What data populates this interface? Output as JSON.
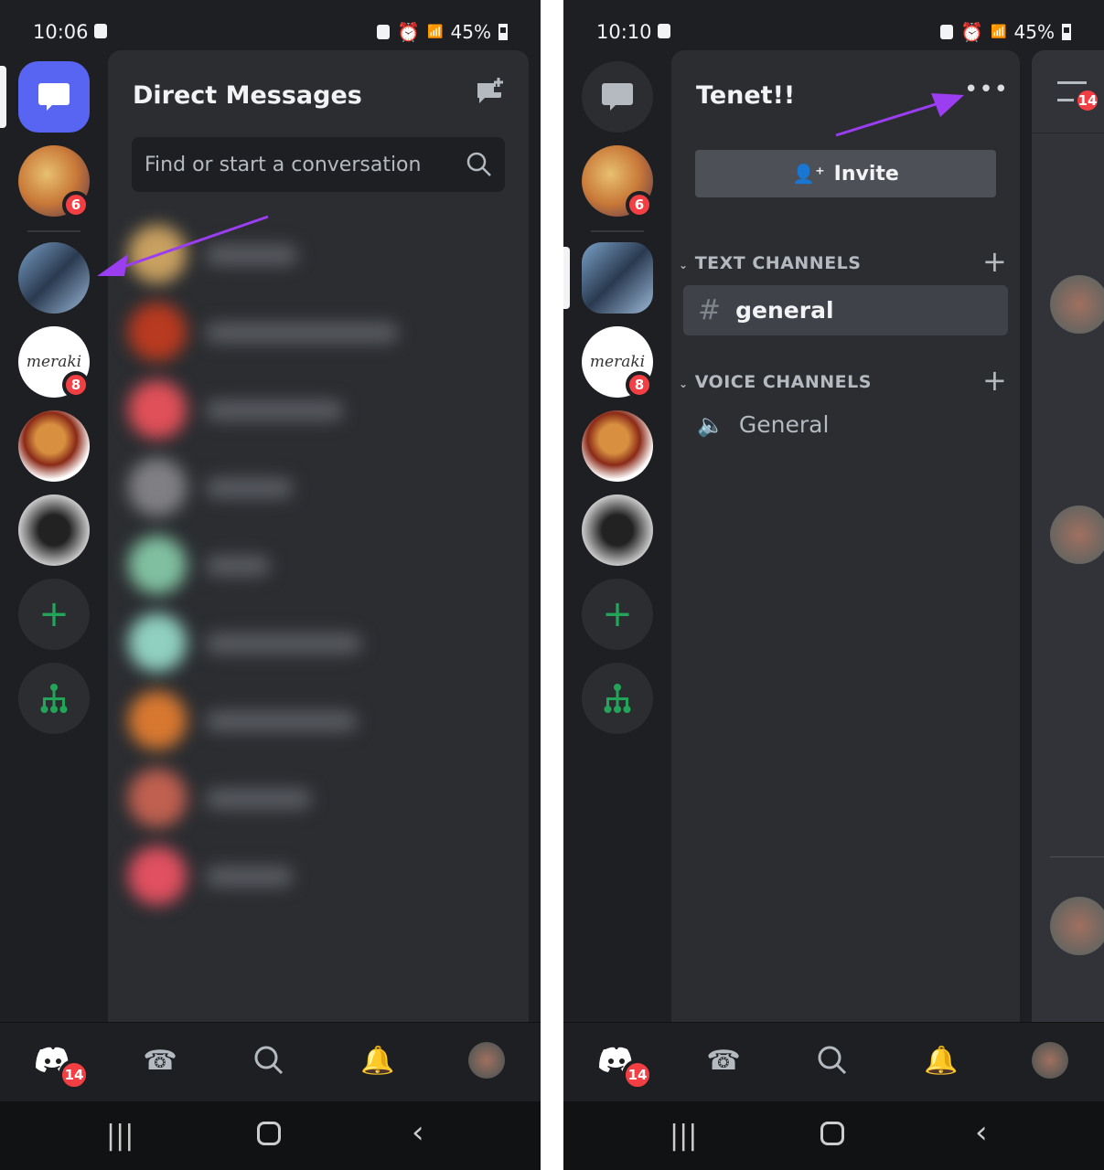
{
  "left": {
    "status": {
      "time": "10:06",
      "battery": "45%"
    },
    "title": "Direct Messages",
    "search": {
      "placeholder": "Find or start a conversation"
    },
    "badges": {
      "server1": "6",
      "server3": "8",
      "home": "14"
    }
  },
  "right": {
    "status": {
      "time": "10:10",
      "battery": "45%"
    },
    "server_name": "Tenet!!",
    "invite_label": "Invite",
    "text_category": "TEXT CHANNELS",
    "voice_category": "VOICE CHANNELS",
    "text_channel": "general",
    "voice_channel": "General",
    "badges": {
      "server1": "6",
      "server3": "8",
      "home": "14",
      "members": "14"
    }
  },
  "colors": {
    "accent": "#5865f2",
    "green": "#23a559",
    "badge": "#f23f43",
    "arrow": "#9b3df0"
  },
  "icons": [
    "dm-icon",
    "new-dm-icon",
    "search-icon",
    "add-server-icon",
    "discover-icon",
    "discord-icon",
    "friends-icon",
    "notifications-icon",
    "avatar",
    "more-icon",
    "add-user-icon",
    "hashtag-icon",
    "speaker-icon",
    "members-icon"
  ]
}
